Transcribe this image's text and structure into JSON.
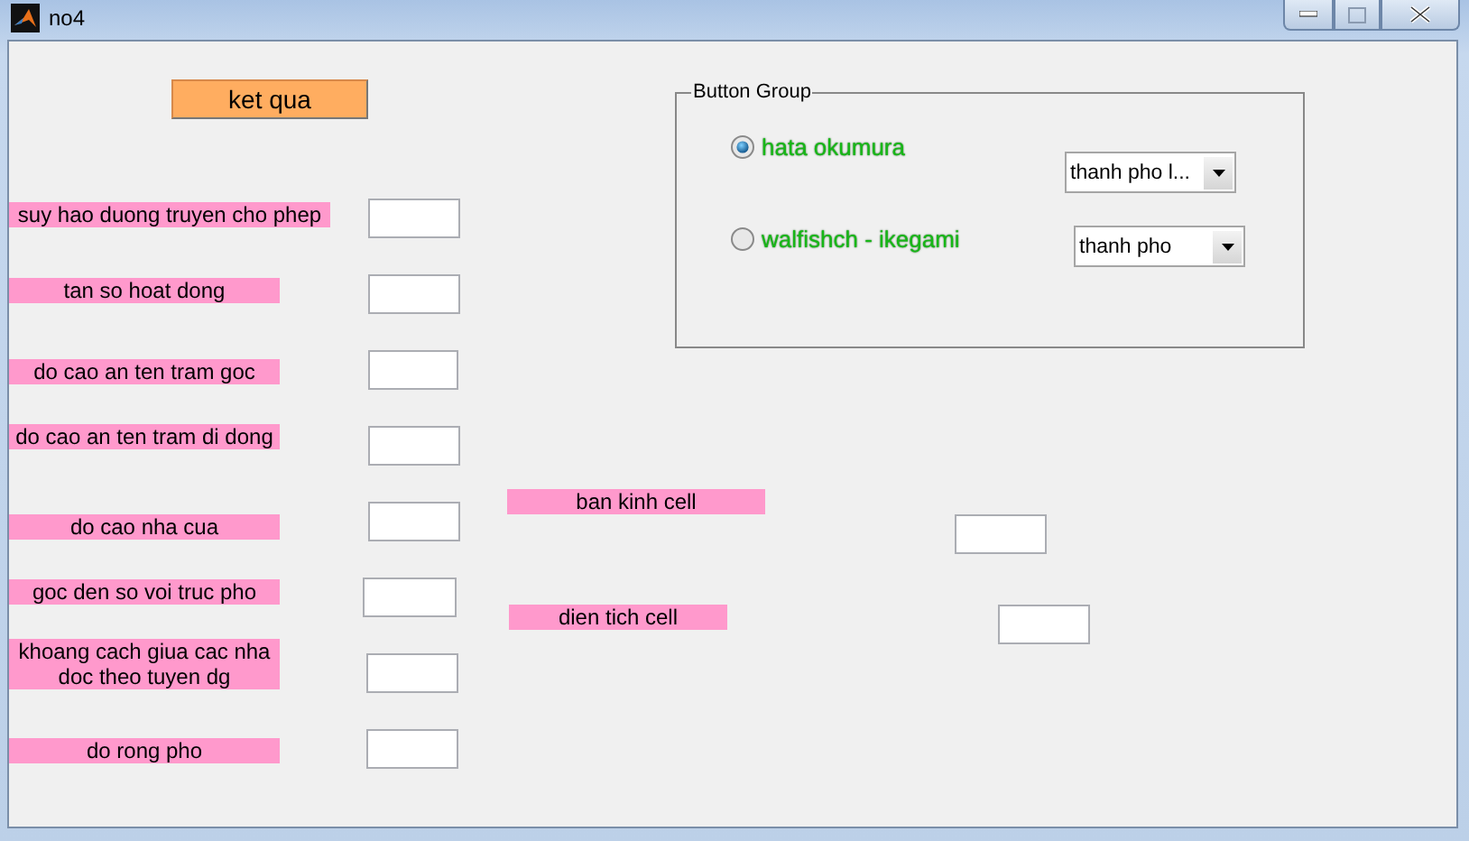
{
  "window": {
    "title": "no4"
  },
  "result_button": {
    "label": "ket qua"
  },
  "inputs": [
    {
      "label": "suy hao duong truyen cho phep"
    },
    {
      "label": "tan so hoat dong"
    },
    {
      "label": "do cao an ten tram goc"
    },
    {
      "label": "do cao an ten tram di dong"
    },
    {
      "label": "do cao nha cua"
    },
    {
      "label": "goc den so voi truc pho"
    },
    {
      "label": "khoang cach giua cac nha\ndoc theo tuyen dg"
    },
    {
      "label": "do rong pho"
    }
  ],
  "outputs": [
    {
      "label": "ban kinh cell"
    },
    {
      "label": "dien tich cell"
    }
  ],
  "button_group": {
    "title": "Button Group",
    "options": [
      {
        "label": "hata okumura",
        "selected": true,
        "dropdown": "thanh pho l..."
      },
      {
        "label": "walfishch - ikegami",
        "selected": false,
        "dropdown": "thanh pho"
      }
    ]
  }
}
